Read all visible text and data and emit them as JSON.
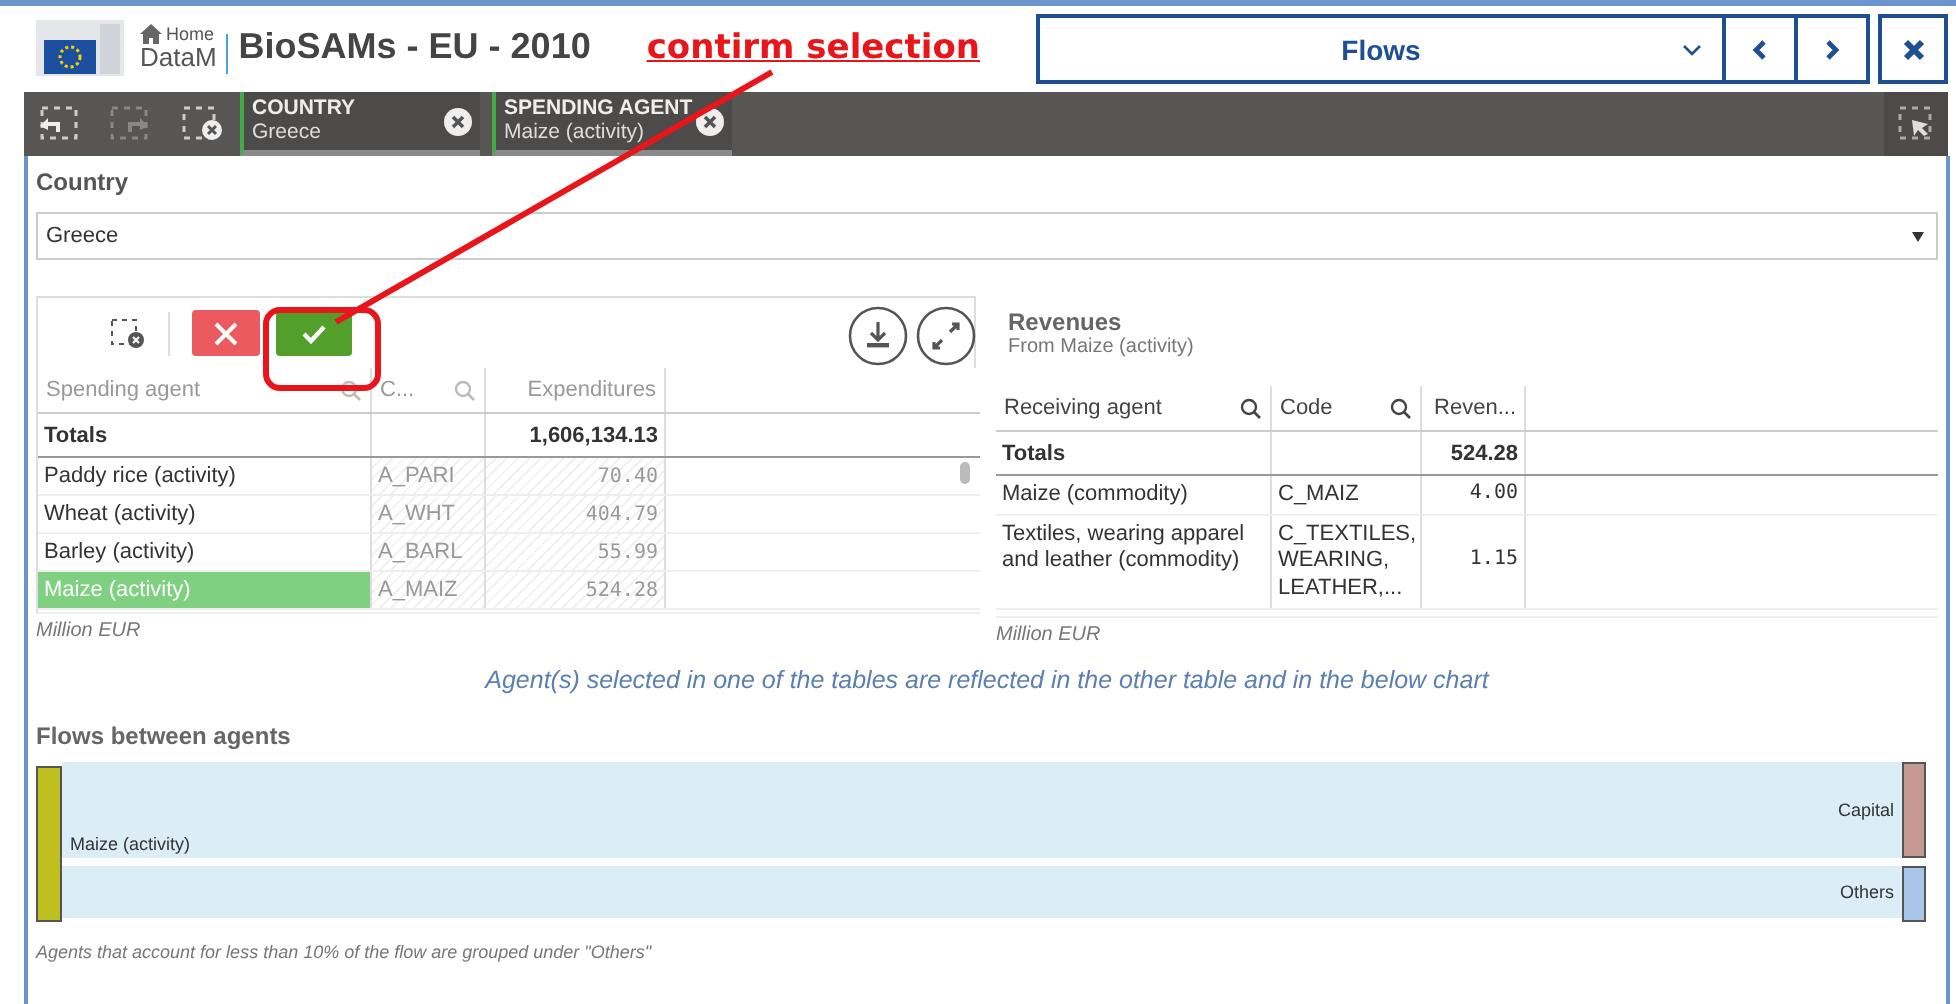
{
  "header": {
    "home_label": "Home",
    "brand": "DataM",
    "title": "BioSAMs - EU - 2010",
    "sheet": "Flows"
  },
  "annotation": {
    "text": "contirm selection"
  },
  "selections": [
    {
      "field": "COUNTRY",
      "value": "Greece"
    },
    {
      "field": "SPENDING AGENT",
      "value": "Maize (activity)"
    }
  ],
  "country_filter": {
    "label": "Country",
    "value": "Greece"
  },
  "spending_table": {
    "columns": [
      "Spending agent",
      "C...",
      "Expenditures"
    ],
    "totals": {
      "label": "Totals",
      "value": "1,606,134.13"
    },
    "rows": [
      {
        "agent": "Paddy rice (activity)",
        "code": "A_PARI",
        "value": "70.40",
        "selected": false
      },
      {
        "agent": "Wheat (activity)",
        "code": "A_WHT",
        "value": "404.79",
        "selected": false
      },
      {
        "agent": "Barley (activity)",
        "code": "A_BARL",
        "value": "55.99",
        "selected": false
      },
      {
        "agent": "Maize (activity)",
        "code": "A_MAIZ",
        "value": "524.28",
        "selected": true
      }
    ],
    "unit": "Million EUR"
  },
  "revenues": {
    "title": "Revenues",
    "subtitle": "From Maize (activity)",
    "columns": [
      "Receiving agent",
      "Code",
      "Reven..."
    ],
    "totals": {
      "label": "Totals",
      "value": "524.28"
    },
    "rows": [
      {
        "agent": "Maize (commodity)",
        "code": "C_MAIZ",
        "value": "4.00"
      },
      {
        "agent": "Textiles, wearing apparel and leather (commodity)",
        "code": "C_TEXTILES, WEARING, LEATHER,...",
        "value": "1.15"
      }
    ],
    "unit": "Million EUR"
  },
  "note": "Agent(s) selected in one of the tables are reflected in the other table and in the below chart",
  "flows": {
    "title": "Flows between agents",
    "source": {
      "label": "Maize (activity)",
      "color": "#bfbf1f"
    },
    "targets": [
      {
        "label": "Capital",
        "color": "#c49a92"
      },
      {
        "label": "Others",
        "color": "#a9c6e8"
      }
    ],
    "footnote": "Agents that account for less than 10% of the flow are grouped under \"Others\""
  }
}
